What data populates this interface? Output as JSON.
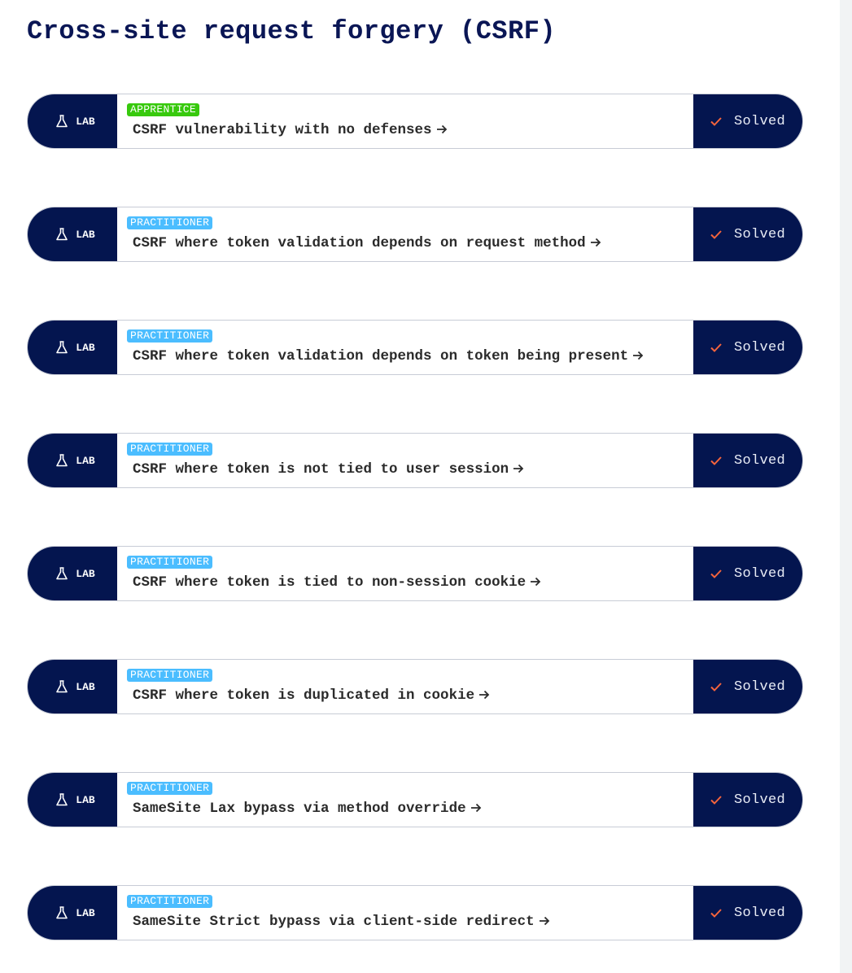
{
  "page": {
    "title": "Cross-site request forgery (CSRF)"
  },
  "colors": {
    "navy": "#04154f",
    "apprentice": "#37c90d",
    "practitioner": "#4bbdff",
    "check": "#f6643c"
  },
  "labs": [
    {
      "tag": "LAB",
      "level": "APPRENTICE",
      "level_class": "apprentice",
      "title": "CSRF vulnerability with no defenses",
      "status": "Solved"
    },
    {
      "tag": "LAB",
      "level": "PRACTITIONER",
      "level_class": "practitioner",
      "title": "CSRF where token validation depends on request method",
      "status": "Solved"
    },
    {
      "tag": "LAB",
      "level": "PRACTITIONER",
      "level_class": "practitioner",
      "title": "CSRF where token validation depends on token being present",
      "status": "Solved"
    },
    {
      "tag": "LAB",
      "level": "PRACTITIONER",
      "level_class": "practitioner",
      "title": "CSRF where token is not tied to user session",
      "status": "Solved"
    },
    {
      "tag": "LAB",
      "level": "PRACTITIONER",
      "level_class": "practitioner",
      "title": "CSRF where token is tied to non-session cookie",
      "status": "Solved"
    },
    {
      "tag": "LAB",
      "level": "PRACTITIONER",
      "level_class": "practitioner",
      "title": "CSRF where token is duplicated in cookie",
      "status": "Solved"
    },
    {
      "tag": "LAB",
      "level": "PRACTITIONER",
      "level_class": "practitioner",
      "title": "SameSite Lax bypass via method override",
      "status": "Solved"
    },
    {
      "tag": "LAB",
      "level": "PRACTITIONER",
      "level_class": "practitioner",
      "title": "SameSite Strict bypass via client-side redirect",
      "status": "Solved"
    }
  ]
}
